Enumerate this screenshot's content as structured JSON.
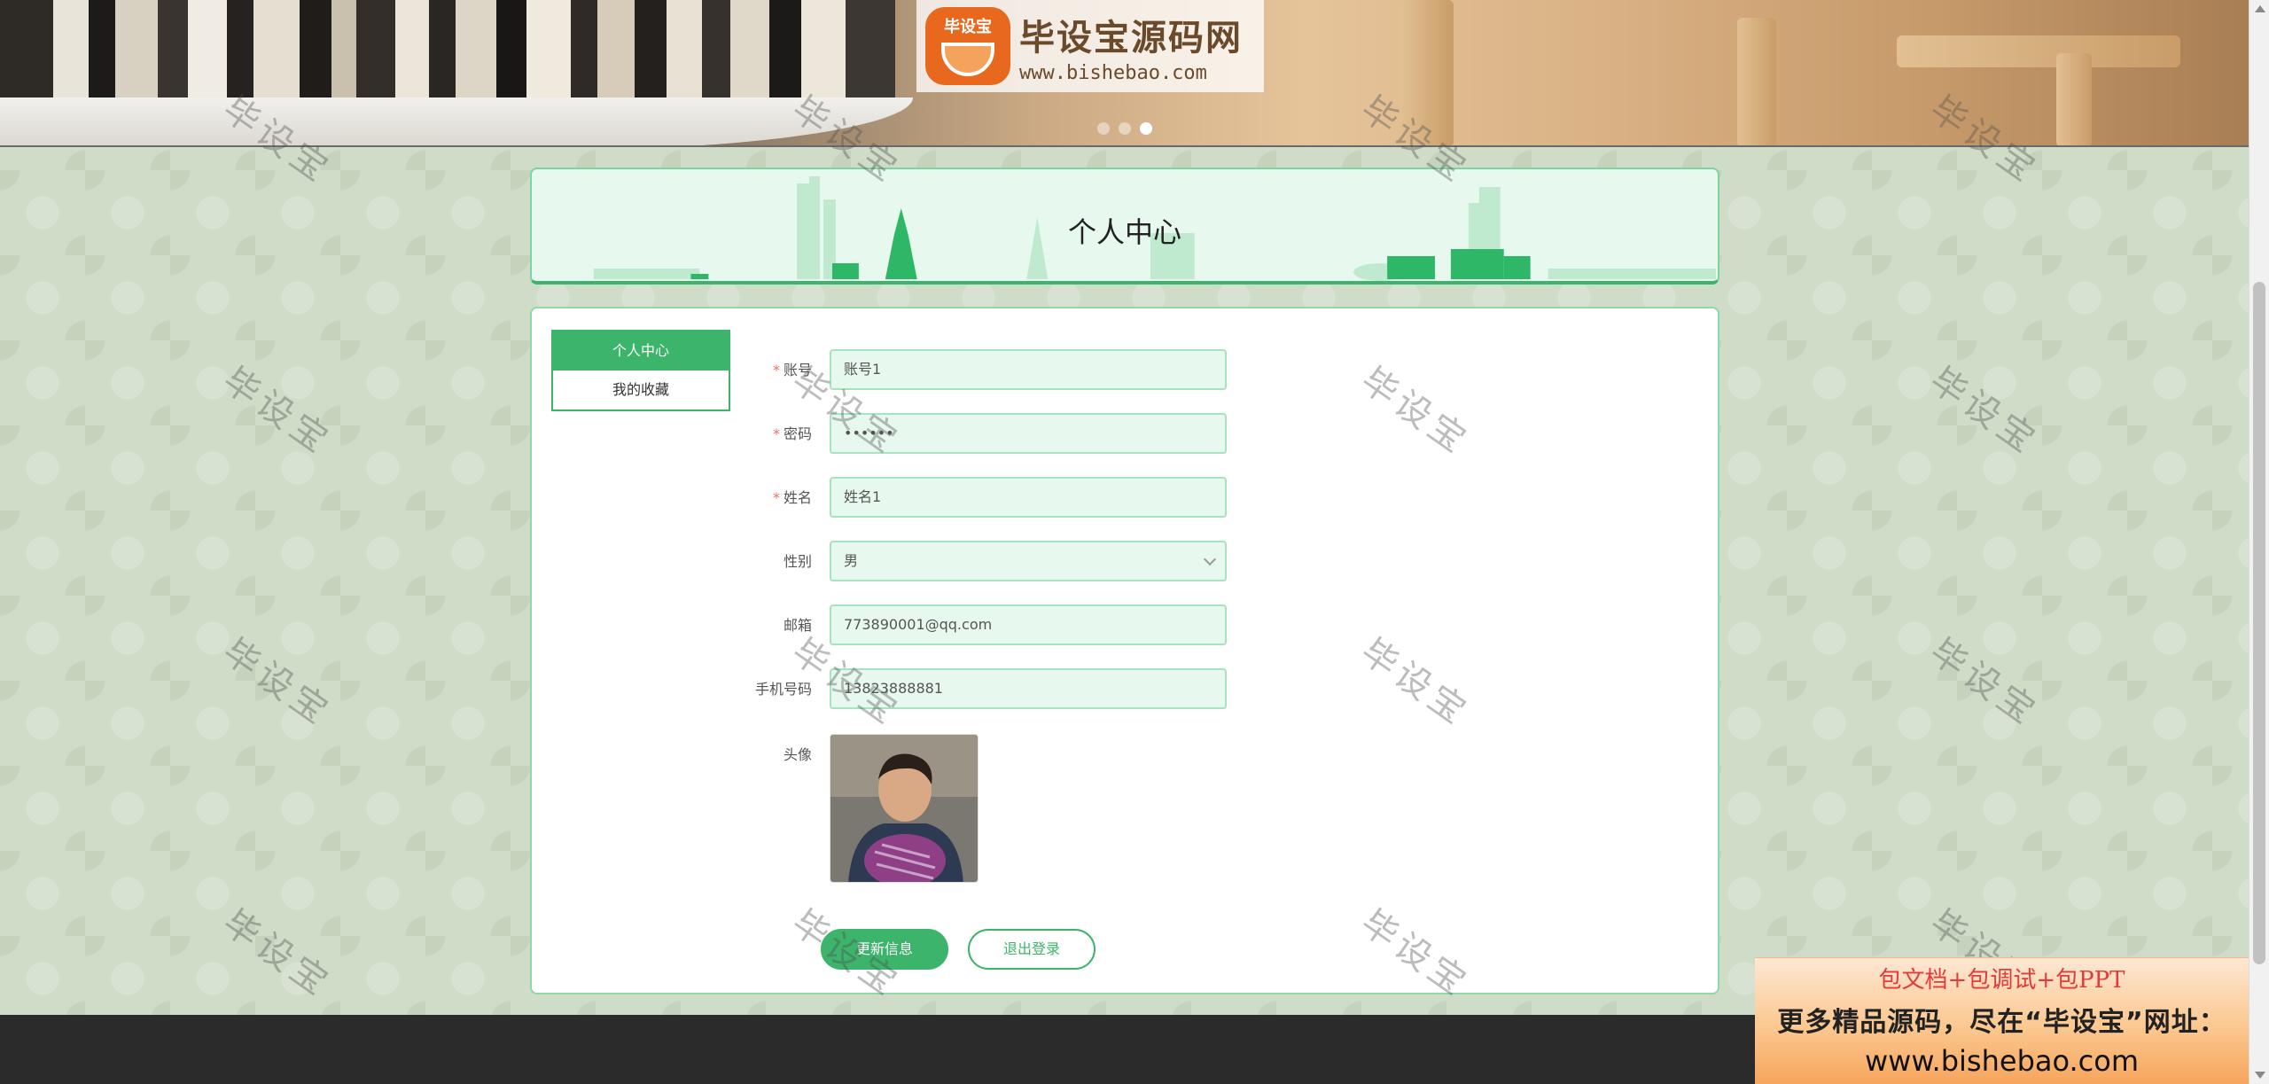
{
  "logo": {
    "title": "毕设宝源码网",
    "url": "www.bishebao.com",
    "badge": "毕设宝"
  },
  "carousel": {
    "count": 3,
    "active_index": 2
  },
  "page": {
    "title": "个人中心"
  },
  "side_menu": {
    "items": [
      {
        "label": "个人中心",
        "active": true
      },
      {
        "label": "我的收藏",
        "active": false
      }
    ]
  },
  "form": {
    "account": {
      "label": "账号",
      "required": true,
      "value": "账号1"
    },
    "password": {
      "label": "密码",
      "required": true,
      "value": "••••••"
    },
    "name": {
      "label": "姓名",
      "required": true,
      "value": "姓名1"
    },
    "gender": {
      "label": "性别",
      "required": false,
      "value": "男"
    },
    "email": {
      "label": "邮箱",
      "required": false,
      "value": "773890001@qq.com"
    },
    "phone": {
      "label": "手机号码",
      "required": false,
      "value": "13823888881"
    },
    "avatar": {
      "label": "头像"
    }
  },
  "actions": {
    "update_label": "更新信息",
    "logout_label": "退出登录"
  },
  "watermark": {
    "text": "毕设宝"
  },
  "ad": {
    "line1": "包文档+包调试+包PPT",
    "line2": "更多精品源码，尽在“毕设宝”网址：",
    "line3": "www.bishebao.com"
  },
  "colors": {
    "primary": "#3cb46b",
    "input_bg": "#e7f8ee",
    "footer": "#2b2b2b",
    "required": "#f56c6c"
  }
}
